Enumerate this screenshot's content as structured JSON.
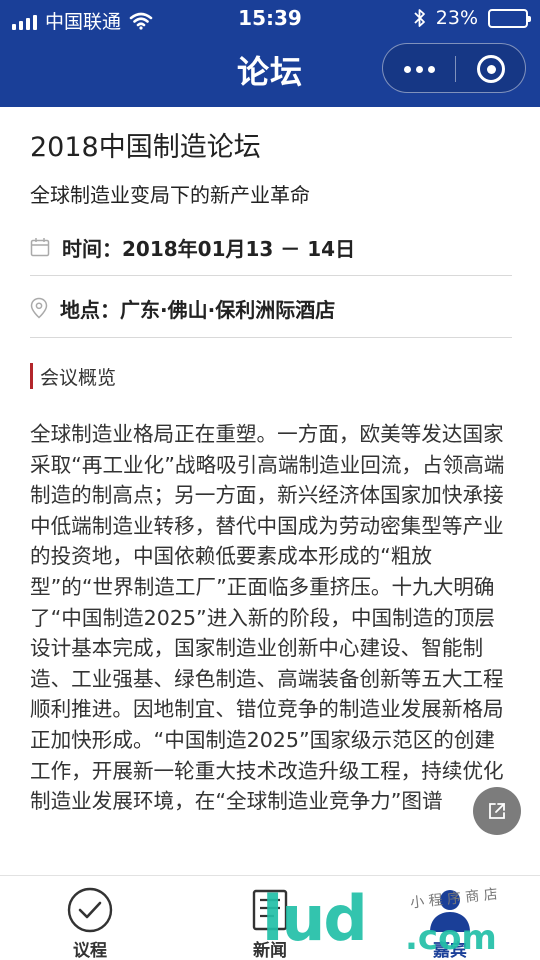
{
  "status_bar": {
    "carrier": "中国联通",
    "time": "15:39",
    "battery": "23%",
    "battery_level": 0.23,
    "battery_color": "#f5c518"
  },
  "nav": {
    "title": "论坛",
    "bg_color": "#1a3f98"
  },
  "event": {
    "title": "2018中国制造论坛",
    "subtitle": "全球制造业变局下的新产业革命",
    "time_label": "时间：",
    "time_value": "2018年01月13 － 14日",
    "place_label": "地点：",
    "place_value": "广东·佛山·保利洲际酒店"
  },
  "section": {
    "heading": "会议概览",
    "accent_color": "#b3262b",
    "body": "全球制造业格局正在重塑。一方面，欧美等发达国家采取“再工业化”战略吸引高端制造业回流，占领高端制造的制高点；另一方面，新兴经济体国家加快承接中低端制造业转移，替代中国成为劳动密集型等产业的投资地，中国依赖低要素成本形成的“粗放型”的“世界制造工厂”正面临多重挤压。十九大明确了“中国制造2025”进入新的阶段，中国制造的顶层设计基本完成，国家制造业创新中心建设、智能制造、工业强基、绿色制造、高端装备创新等五大工程顺利推进。因地制宜、错位竞争的制造业发展新格局正加快形成。“中国制造2025”国家级示范区的创建工作，开展新一轮重大技术改造升级工程，持续优化制造业发展环境，在“全球制造业竞争力”图谱"
  },
  "tabs": [
    {
      "label": "议程",
      "icon": "check-circle-icon"
    },
    {
      "label": "新闻",
      "icon": "document-icon"
    },
    {
      "label": "嘉宾",
      "icon": "person-icon"
    }
  ],
  "watermark": {
    "brand": "lud",
    "domain": ".com",
    "cn": "小 程 序 商 店"
  }
}
